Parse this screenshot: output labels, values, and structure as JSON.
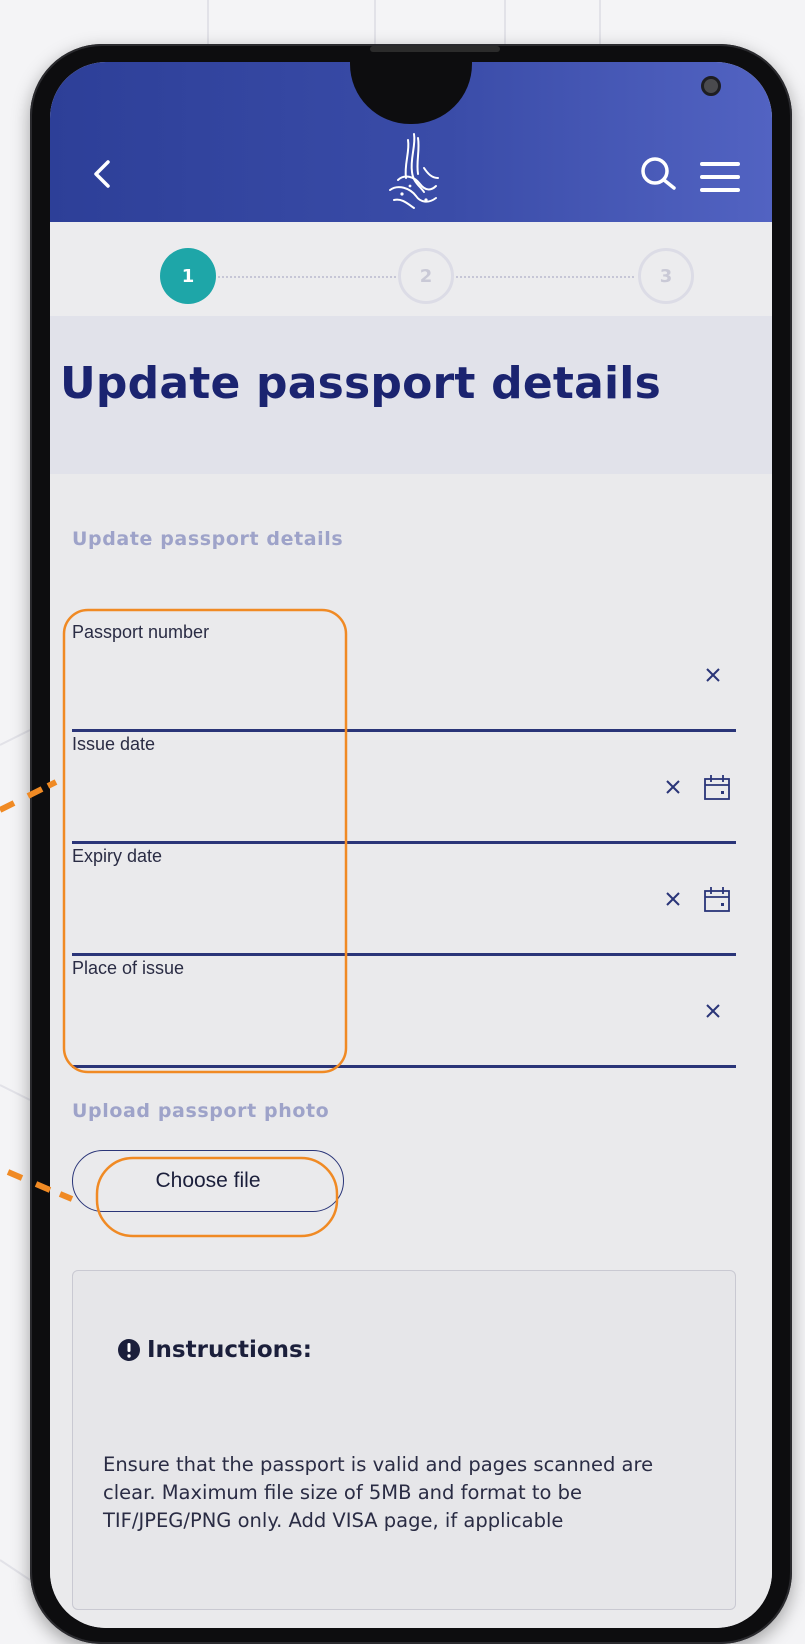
{
  "colors": {
    "header_gradient_start": "#2d3f98",
    "header_gradient_end": "#5263c2",
    "title_color": "#1b2470",
    "step_active": "#1ea6a8",
    "annotation": "#f08a24"
  },
  "header": {
    "back_icon": "chevron-left-icon",
    "logo_icon": "calligraphy-logo-icon",
    "search_icon": "search-icon",
    "menu_icon": "hamburger-menu-icon"
  },
  "stepper": {
    "steps": [
      "1",
      "2",
      "3"
    ],
    "current_step": 1
  },
  "page": {
    "title": "Update passport details"
  },
  "form": {
    "section_title": "Update passport details",
    "fields": [
      {
        "label": "Passport number",
        "value": "",
        "has_calendar": false
      },
      {
        "label": "Issue date",
        "value": "",
        "has_calendar": true
      },
      {
        "label": "Expiry date",
        "value": "",
        "has_calendar": true
      },
      {
        "label": "Place of issue",
        "value": "",
        "has_calendar": false
      }
    ],
    "upload_title": "Upload passport photo",
    "choose_file_label": "Choose file"
  },
  "instructions": {
    "icon": "exclamation-circle-icon",
    "title": "Instructions:",
    "text": "Ensure that the passport is valid and pages scanned are clear. Maximum file size of 5MB and format to be TIF/JPEG/PNG only. Add VISA page, if applicable"
  }
}
